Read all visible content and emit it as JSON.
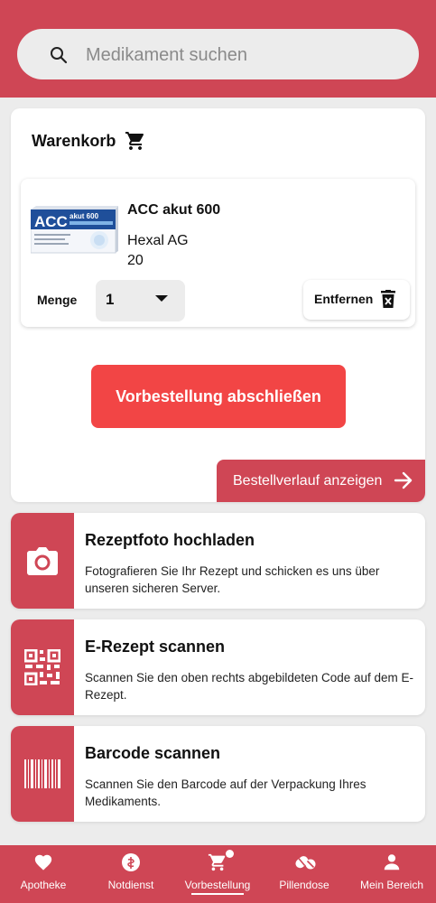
{
  "search": {
    "placeholder": "Medikament suchen"
  },
  "cart": {
    "title": "Warenkorb",
    "item": {
      "name": "ACC akut 600",
      "maker": "Hexal AG",
      "quantity_text": "20",
      "image_brand": "ACC",
      "image_sub": "akut 600",
      "menge_label": "Menge",
      "menge_value": "1",
      "remove_label": "Entfernen"
    },
    "order_button": "Vorbestellung abschließen",
    "history_button": "Bestellverlauf anzeigen"
  },
  "actions": [
    {
      "title": "Rezeptfoto hochladen",
      "desc": "Fotografieren Sie Ihr Rezept und schicken es uns über unseren sicheren Server.",
      "icon": "camera-icon"
    },
    {
      "title": "E-Rezept scannen",
      "desc": "Scannen Sie den oben rechts abgebildeten Code auf dem E-Rezept.",
      "icon": "qr-code-icon"
    },
    {
      "title": "Barcode scannen",
      "desc": "Scannen Sie den Barcode auf der Verpackung Ihres Medikaments.",
      "icon": "barcode-icon"
    }
  ],
  "nav": [
    {
      "label": "Apotheke",
      "icon": "heart-icon"
    },
    {
      "label": "Notdienst",
      "icon": "pharmacy-icon"
    },
    {
      "label": "Vorbestellung",
      "icon": "cart-icon",
      "active": true
    },
    {
      "label": "Pillendose",
      "icon": "pill-icon"
    },
    {
      "label": "Mein Bereich",
      "icon": "person-icon"
    }
  ],
  "colors": {
    "brand": "#cf4655",
    "accent_button": "#f24545",
    "background": "#ececec"
  }
}
